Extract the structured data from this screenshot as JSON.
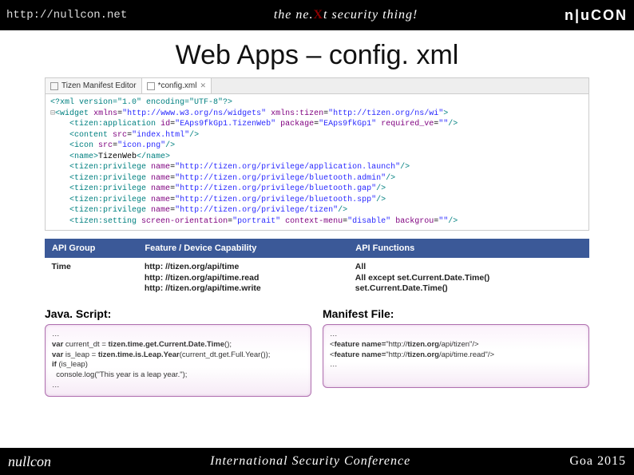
{
  "header": {
    "url": "http://nullcon.net",
    "tagline_before": "the ne.",
    "tagline_x": "X",
    "tagline_after": "t security thing!",
    "brand": "n|uCON"
  },
  "title": "Web Apps – config. xml",
  "editor": {
    "tabs": [
      {
        "label": "Tizen Manifest Editor"
      },
      {
        "label": "*config.xml"
      }
    ],
    "xml_lines": [
      {
        "decl": true,
        "text": "<?xml version=\"1.0\" encoding=\"UTF-8\"?>"
      },
      {
        "tag": "widget",
        "attrs": [
          [
            "xmlns",
            "http://www.w3.org/ns/widgets"
          ],
          [
            "xmlns:tizen",
            "http://tizen.org/ns/wi"
          ]
        ],
        "collapse": true
      },
      {
        "indent": 1,
        "tag": "tizen:application",
        "attrs": [
          [
            "id",
            "EAps9fkGp1.TizenWeb"
          ],
          [
            "package",
            "EAps9fkGp1"
          ],
          [
            "required_ve",
            ""
          ]
        ],
        "self": true
      },
      {
        "indent": 1,
        "tag": "content",
        "attrs": [
          [
            "src",
            "index.html"
          ]
        ],
        "self": true
      },
      {
        "indent": 1,
        "tag": "icon",
        "attrs": [
          [
            "src",
            "icon.png"
          ]
        ],
        "self": true
      },
      {
        "indent": 1,
        "tag": "name",
        "inner": "TizenWeb"
      },
      {
        "indent": 1,
        "tag": "tizen:privilege",
        "attrs": [
          [
            "name",
            "http://tizen.org/privilege/application.launch"
          ]
        ],
        "self": true
      },
      {
        "indent": 1,
        "tag": "tizen:privilege",
        "attrs": [
          [
            "name",
            "http://tizen.org/privilege/bluetooth.admin"
          ]
        ],
        "self": true
      },
      {
        "indent": 1,
        "tag": "tizen:privilege",
        "attrs": [
          [
            "name",
            "http://tizen.org/privilege/bluetooth.gap"
          ]
        ],
        "self": true
      },
      {
        "indent": 1,
        "tag": "tizen:privilege",
        "attrs": [
          [
            "name",
            "http://tizen.org/privilege/bluetooth.spp"
          ]
        ],
        "self": true
      },
      {
        "indent": 1,
        "tag": "tizen:privilege",
        "attrs": [
          [
            "name",
            "http://tizen.org/privilege/tizen"
          ]
        ],
        "self": true
      },
      {
        "indent": 1,
        "tag": "tizen:setting",
        "attrs": [
          [
            "screen-orientation",
            "portrait"
          ],
          [
            "context-menu",
            "disable"
          ],
          [
            "backgrou",
            ""
          ]
        ],
        "self": true
      }
    ]
  },
  "api_table": {
    "head": [
      "API Group",
      "Feature / Device Capability",
      "API Functions"
    ],
    "row": {
      "group": "Time",
      "features": "http: //tizen.org/api/time\nhttp: //tizen.org/api/time.read\nhttp: //tizen.org/api/time.write",
      "funcs": "All\nAll except set.Current.Date.Time()\nset.Current.Date.Time()"
    }
  },
  "panels": {
    "js": {
      "head": "Java. Script:",
      "body": "…\nvar current_dt = tizen.time.get.Current.Date.Time();\nvar is_leap = tizen.time.is.Leap.Year(current_dt.get.Full.Year());\nif (is_leap)\n  console.log(\"This year is a leap year.\");\n…"
    },
    "manifest": {
      "head": "Manifest File:",
      "body": "…\n<feature name=\"http://tizen.org/api/tizen\"/>\n<feature name=\"http://tizen.org/api/time.read\"/>\n…"
    }
  },
  "footer": {
    "left": "nullcon",
    "center": "International Security Conference",
    "right": "Goa  2015"
  }
}
